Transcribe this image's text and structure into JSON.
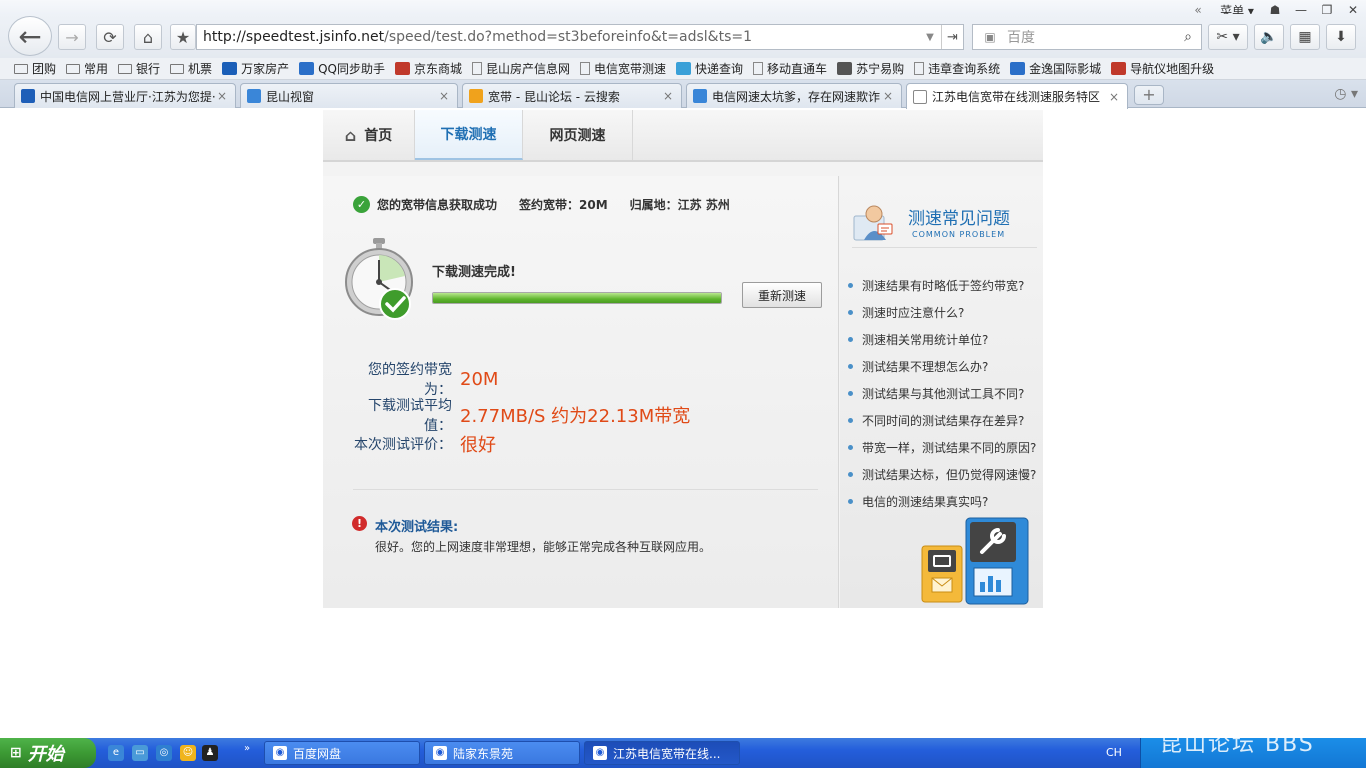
{
  "browser": {
    "menu_label": "菜单",
    "url": {
      "host": "http://speedtest.jsinfo.net",
      "path": "/speed/test.do?method=st3beforeinfo&t=adsl&ts=1"
    },
    "search_placeholder": "百度",
    "bookmarks": [
      {
        "label": "团购",
        "icon": "folder-icon"
      },
      {
        "label": "常用",
        "icon": "folder-icon"
      },
      {
        "label": "银行",
        "icon": "folder-icon"
      },
      {
        "label": "机票",
        "icon": "folder-icon"
      },
      {
        "label": "万家房产",
        "icon": "site-icon"
      },
      {
        "label": "QQ同步助手",
        "icon": "site-icon"
      },
      {
        "label": "京东商城",
        "icon": "site-icon"
      },
      {
        "label": "昆山房产信息网",
        "icon": "page-icon"
      },
      {
        "label": "电信宽带测速",
        "icon": "page-icon"
      },
      {
        "label": "快递查询",
        "icon": "site-icon"
      },
      {
        "label": "移动直通车",
        "icon": "page-icon"
      },
      {
        "label": "苏宁易购",
        "icon": "site-icon"
      },
      {
        "label": "违章查询系统",
        "icon": "page-icon"
      },
      {
        "label": "金逸国际影城",
        "icon": "site-icon"
      },
      {
        "label": "导航仪地图升级",
        "icon": "site-icon"
      }
    ],
    "tabs": [
      {
        "title": "中国电信网上营业厅·江苏为您提·",
        "active": false
      },
      {
        "title": "昆山视窗",
        "active": false
      },
      {
        "title": "宽带 - 昆山论坛 - 云搜索",
        "active": false
      },
      {
        "title": "电信网速太坑爹，存在网速欺诈，",
        "active": false
      },
      {
        "title": "江苏电信宽带在线测速服务特区「",
        "active": true
      }
    ]
  },
  "page": {
    "nav": {
      "home": "首页",
      "download_test": "下载测速",
      "web_test": "网页测速"
    },
    "info": {
      "success": "您的宽带信息获取成功",
      "contract": "签约宽带：20M",
      "location": "归属地：江苏 苏州"
    },
    "test": {
      "done_label": "下载测速完成!",
      "progress_percent": 100,
      "retest_button": "重新测速"
    },
    "results": {
      "contract_label": "您的签约带宽为：",
      "contract_value": "20M",
      "avg_label": "下载测试平均值：",
      "avg_value": "2.77MB/S 约为22.13M带宽",
      "rating_label": "本次测试评价：",
      "rating_value": "很好"
    },
    "conclusion": {
      "title": "本次测试结果:",
      "text": "很好。您的上网速度非常理想，能够正常完成各种互联网应用。"
    },
    "faq": {
      "title": "测速常见问题",
      "subtitle": "COMMON PROBLEM",
      "items": [
        "测速结果有时略低于签约带宽?",
        "测速时应注意什么?",
        "测速相关常用统计单位?",
        "测试结果不理想怎么办?",
        "测试结果与其他测试工具不同?",
        "不同时间的测试结果存在差异?",
        "带宽一样，测试结果不同的原因?",
        "测试结果达标，但仍觉得网速慢?",
        "电信的测速结果真实吗?"
      ]
    }
  },
  "taskbar": {
    "start_label": "开始",
    "tasks": [
      {
        "label": "百度网盘",
        "active": false
      },
      {
        "label": "陆家东景苑",
        "active": false
      },
      {
        "label": "江苏电信宽带在线...",
        "active": true
      }
    ],
    "lang": "CH",
    "watermark": "昆山论坛 BBS"
  },
  "colors": {
    "accent": "#1f6fb3",
    "result_value": "#e04a17",
    "progress": "#5fb52d",
    "taskbar": "#245edb"
  }
}
